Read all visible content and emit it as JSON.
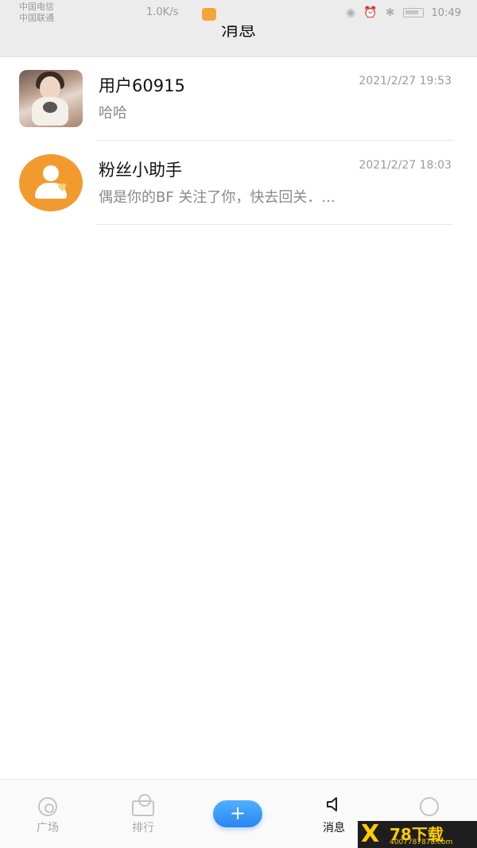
{
  "status_bar": {
    "carrier_line1": "中国电信",
    "carrier_line2": "中国联通",
    "speed": "1.0K/s",
    "time": "10:49"
  },
  "header": {
    "title": "消息"
  },
  "conversations": [
    {
      "name": "用户60915",
      "time": "2021/2/27 19:53",
      "preview": "哈哈",
      "avatar": "user-photo"
    },
    {
      "name": "粉丝小助手",
      "time": "2021/2/27 18:03",
      "preview": "偶是你的BF 关注了你，快去回关．...",
      "avatar": "fan-helper"
    }
  ],
  "tabbar": {
    "tabs": [
      {
        "label": "广场",
        "icon": "disc-icon"
      },
      {
        "label": "排行",
        "icon": "rank-icon"
      },
      {
        "label": "+",
        "icon": "plus-icon"
      },
      {
        "label": "消息",
        "icon": "speaker-icon",
        "active": true
      },
      {
        "label": "",
        "icon": "user-icon"
      }
    ]
  },
  "watermark": {
    "brand": "78下载",
    "url": "4007787878.com"
  },
  "colors": {
    "accent_blue": "#2a86f2",
    "fan_orange": "#f39a2e"
  }
}
